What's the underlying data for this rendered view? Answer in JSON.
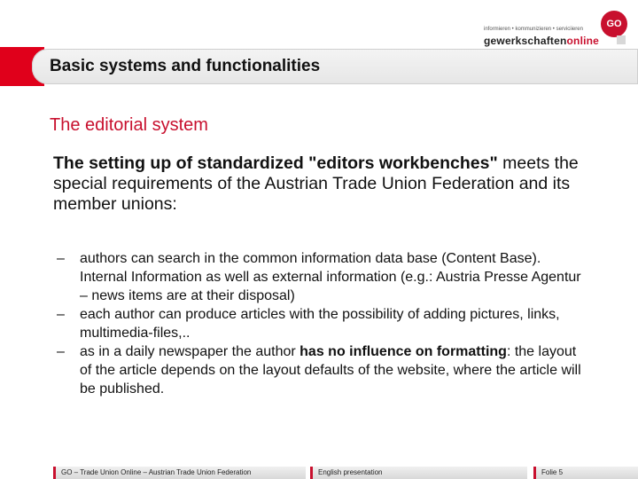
{
  "logo": {
    "tagline": "informieren • kommunizieren • serviciieren",
    "word_main": "gewerkschaften",
    "word_accent": "online",
    "badge": "GO"
  },
  "slide": {
    "title": "Basic systems and functionalities",
    "subtitle": "The editorial system",
    "intro_bold": "The setting up of standardized \"editors workbenches\"",
    "intro_rest": " meets the special requirements of the Austrian Trade Union Federation and its member unions:",
    "bullets": [
      {
        "dash": "–",
        "text": "authors can search in the common information data base (Content Base). Internal Information as well as external information (e.g.: Austria Presse Agentur – news items are at their disposal)"
      },
      {
        "dash": "–",
        "text": "each author can produce articles with the possibility of adding pictures, links, multimedia-files,.."
      },
      {
        "dash": "–",
        "text_a": "as in a daily newspaper the author ",
        "text_bold": "has no influence on formatting",
        "text_b": ": the layout of the article depends on the layout defaults of the website, where the article will be published."
      }
    ]
  },
  "footer": {
    "left": "GO – Trade Union Online – Austrian Trade Union Federation",
    "middle": "English presentation",
    "right": "Folie 5"
  },
  "colors": {
    "accent_red": "#c8102e",
    "title_band": "#e6e6e6"
  }
}
